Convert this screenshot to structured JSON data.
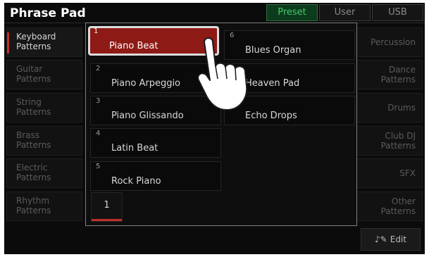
{
  "header": {
    "title": "Phrase Pad",
    "tabs": [
      {
        "label": "Preset",
        "active": true
      },
      {
        "label": "User",
        "active": false
      },
      {
        "label": "USB",
        "active": false
      }
    ]
  },
  "left_categories": [
    {
      "line1": "Keyboard",
      "line2": "Patterns",
      "active": true
    },
    {
      "line1": "Guitar",
      "line2": "Patterns"
    },
    {
      "line1": "String",
      "line2": "Patterns"
    },
    {
      "line1": "Brass",
      "line2": "Patterns"
    },
    {
      "line1": "Electric",
      "line2": "Patterns"
    },
    {
      "line1": "Rhythm",
      "line2": "Patterns"
    }
  ],
  "right_categories": [
    {
      "line1": "Percussion",
      "line2": ""
    },
    {
      "line1": "Dance",
      "line2": "Patterns"
    },
    {
      "line1": "Drums",
      "line2": ""
    },
    {
      "line1": "Club DJ",
      "line2": "Patterns"
    },
    {
      "line1": "SFX",
      "line2": ""
    },
    {
      "line1": "Other",
      "line2": "Patterns"
    }
  ],
  "popup": {
    "pads": [
      {
        "num": "1",
        "name": "Piano Beat",
        "selected": true
      },
      {
        "num": "2",
        "name": "Piano Arpeggio"
      },
      {
        "num": "3",
        "name": "Piano Glissando"
      },
      {
        "num": "4",
        "name": "Latin Beat"
      },
      {
        "num": "5",
        "name": "Rock Piano"
      },
      {
        "num": "6",
        "name": "Blues Organ"
      },
      {
        "num": "7",
        "name": "Heaven Pad"
      },
      {
        "num": "8",
        "name": "Echo Drops"
      }
    ],
    "page": "1"
  },
  "edit": {
    "label": "Edit",
    "icon": "note-edit-icon"
  },
  "colors": {
    "accent_red": "#c0302b",
    "selected_pad": "#8e1a16",
    "active_tab": "#45c96a"
  }
}
